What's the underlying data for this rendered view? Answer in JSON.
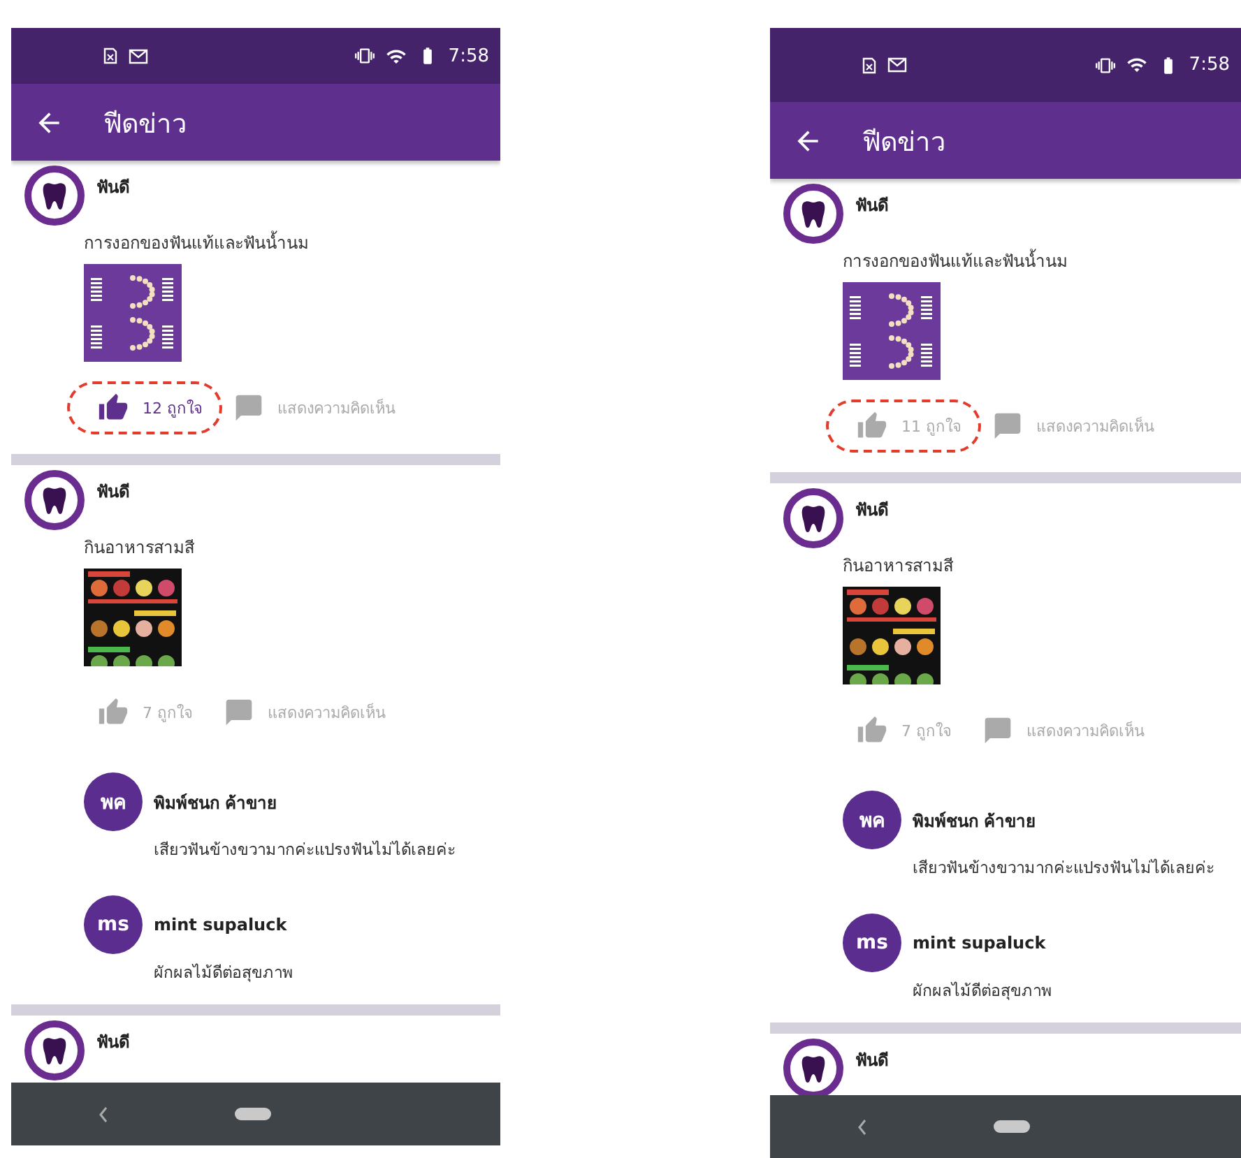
{
  "phones": [
    {
      "status_bar": {
        "time": "7:58"
      },
      "app_bar": {
        "title": "ฟีดข่าว"
      },
      "posts": [
        {
          "author": "ฟันดี",
          "text": "การงอกของฟันแท้และฟันน้ำนม",
          "kind": "teeth",
          "likes": "12 ถูกใจ",
          "liked": true,
          "highlighted": true,
          "comment_label": "แสดงความคิดเห็น"
        },
        {
          "author": "ฟันดี",
          "text": "กินอาหารสามสี",
          "kind": "food",
          "likes": "7 ถูกใจ",
          "liked": false,
          "highlighted": false,
          "comment_label": "แสดงความคิดเห็น",
          "comments": [
            {
              "initials": "พค",
              "name": "พิมพ์ชนก ค้าขาย",
              "text": "เสียวฟันข้างขวามากค่ะแปรงฟันไม่ได้เลยค่ะ"
            },
            {
              "initials": "ms",
              "name": "mint supaluck",
              "text": "ผักผลไม้ดีต่อสุขภาพ"
            }
          ]
        },
        {
          "author": "ฟันดี"
        }
      ]
    },
    {
      "status_bar": {
        "time": "7:58"
      },
      "app_bar": {
        "title": "ฟีดข่าว"
      },
      "posts": [
        {
          "author": "ฟันดี",
          "text": "การงอกของฟันแท้และฟันน้ำนม",
          "kind": "teeth",
          "likes": "11 ถูกใจ",
          "liked": false,
          "highlighted": true,
          "comment_label": "แสดงความคิดเห็น"
        },
        {
          "author": "ฟันดี",
          "text": "กินอาหารสามสี",
          "kind": "food",
          "likes": "7 ถูกใจ",
          "liked": false,
          "highlighted": false,
          "comment_label": "แสดงความคิดเห็น",
          "comments": [
            {
              "initials": "พค",
              "name": "พิมพ์ชนก ค้าขาย",
              "text": "เสียวฟันข้างขวามากค่ะแปรงฟันไม่ได้เลยค่ะ"
            },
            {
              "initials": "ms",
              "name": "mint supaluck",
              "text": "ผักผลไม้ดีต่อสุขภาพ"
            }
          ]
        },
        {
          "author": "ฟันดี"
        }
      ]
    }
  ]
}
